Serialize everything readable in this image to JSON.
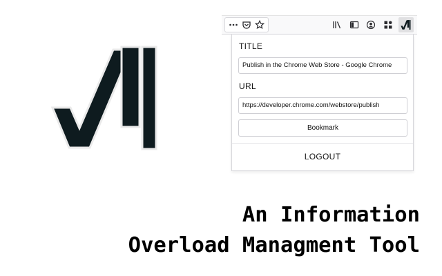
{
  "toolbar": {
    "left_icons": [
      "more-icon",
      "pocket-icon",
      "star-icon"
    ],
    "right_icons": [
      "library-icon",
      "sidebar-icon",
      "account-icon",
      "extensions-icon",
      "app-logo-icon"
    ]
  },
  "popup": {
    "title_label": "TITLE",
    "title_value": "Publish in the Chrome Web Store - Google Chrome",
    "url_label": "URL",
    "url_value": "https://developer.chrome.com/webstore/publish",
    "bookmark_label": "Bookmark",
    "logout_label": "LOGOUT"
  },
  "tagline": {
    "line1": "An Information",
    "line2": "Overload Managment Tool"
  },
  "colors": {
    "logo": "#0e1b1f",
    "text": "#111111",
    "border": "#d7d7db"
  }
}
